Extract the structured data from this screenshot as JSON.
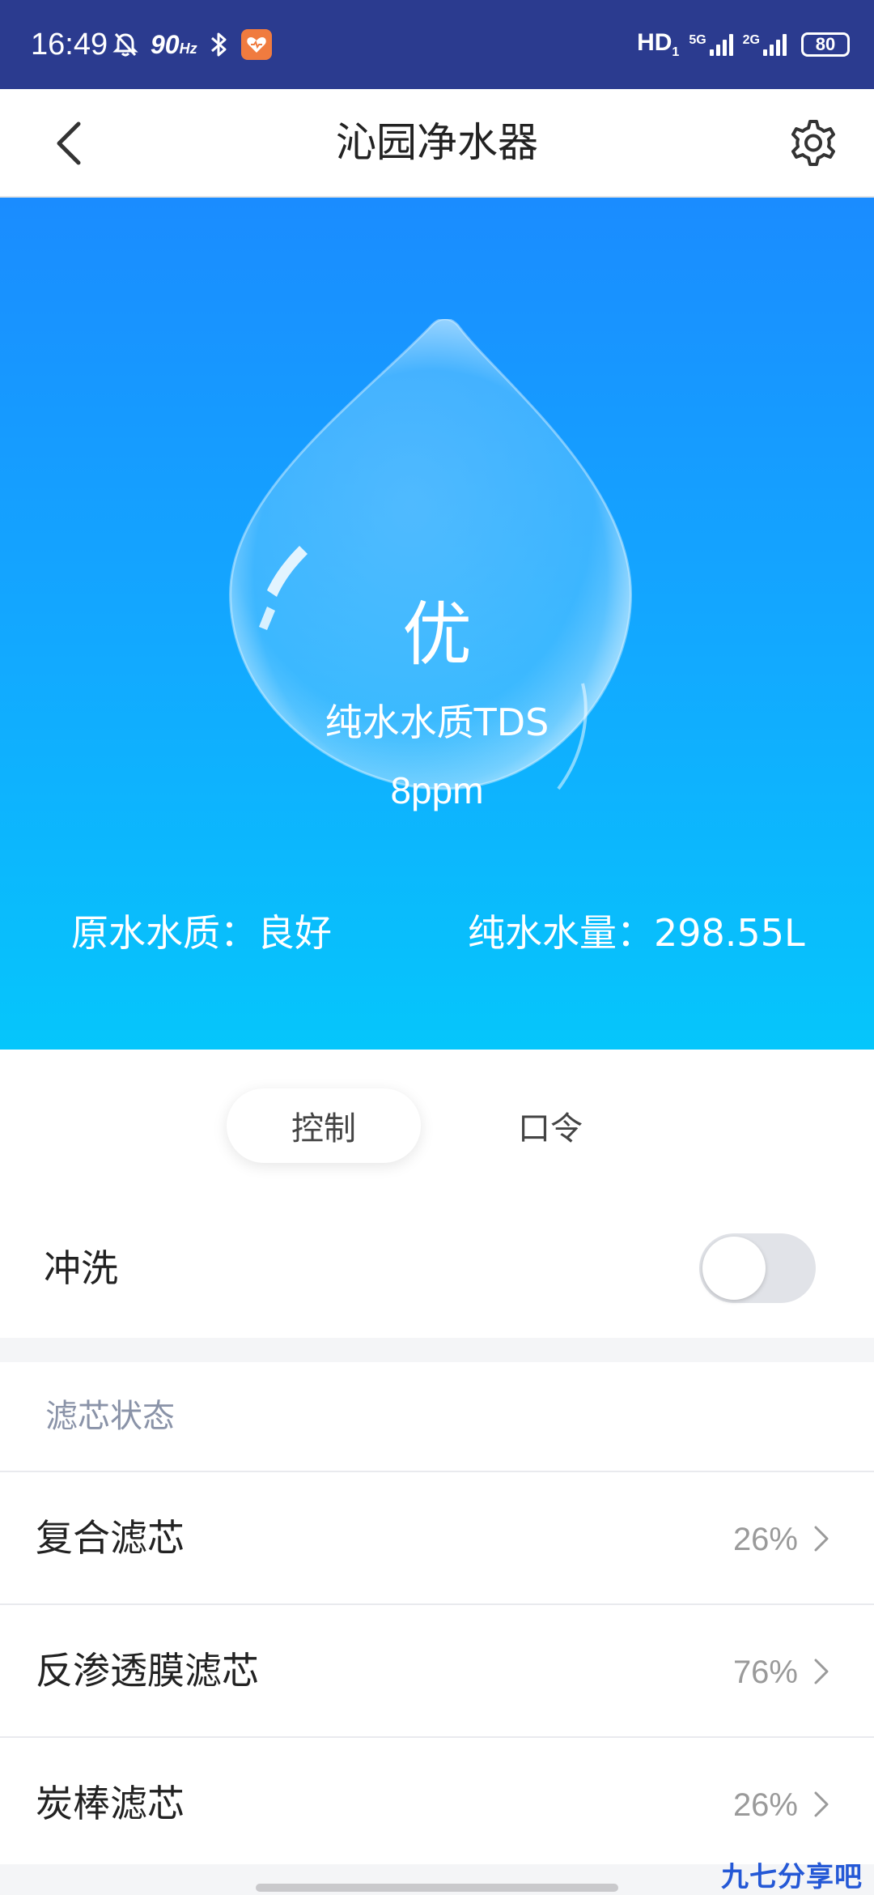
{
  "status_bar": {
    "time": "16:49",
    "refresh_rate": "90",
    "refresh_unit": "Hz",
    "hd_label": "HD",
    "hd_sub": "1",
    "sim1_network": "5G",
    "sim2_network": "2G",
    "battery": "80",
    "icons": [
      "alarm-off-icon",
      "bluetooth-icon",
      "health-app-icon",
      "signal-icon",
      "battery-icon"
    ]
  },
  "header": {
    "title": "沁园净水器",
    "back_icon": "chevron-left-icon",
    "settings_icon": "gear-icon"
  },
  "hero": {
    "grade": "优",
    "tds_label": "纯水水质TDS",
    "tds_value": "8ppm",
    "raw_water": "原水水质：良好",
    "pure_volume": "纯水水量：298.55L"
  },
  "tabs": [
    {
      "label": "控制",
      "active": true
    },
    {
      "label": "口令",
      "active": false
    }
  ],
  "flush": {
    "label": "冲洗",
    "enabled": false
  },
  "filters": {
    "header": "滤芯状态",
    "items": [
      {
        "name": "复合滤芯",
        "percent": "26%"
      },
      {
        "name": "反渗透膜滤芯",
        "percent": "76%"
      },
      {
        "name": "炭棒滤芯",
        "percent": "26%"
      }
    ]
  },
  "watermark": "九七分享吧",
  "colors": {
    "status_bar": "#2b3b8f",
    "hero_top": "#1a8cff",
    "hero_bottom": "#05c6fb",
    "toggle_off": "#e1e3e8",
    "section_label": "#8a93a8"
  }
}
